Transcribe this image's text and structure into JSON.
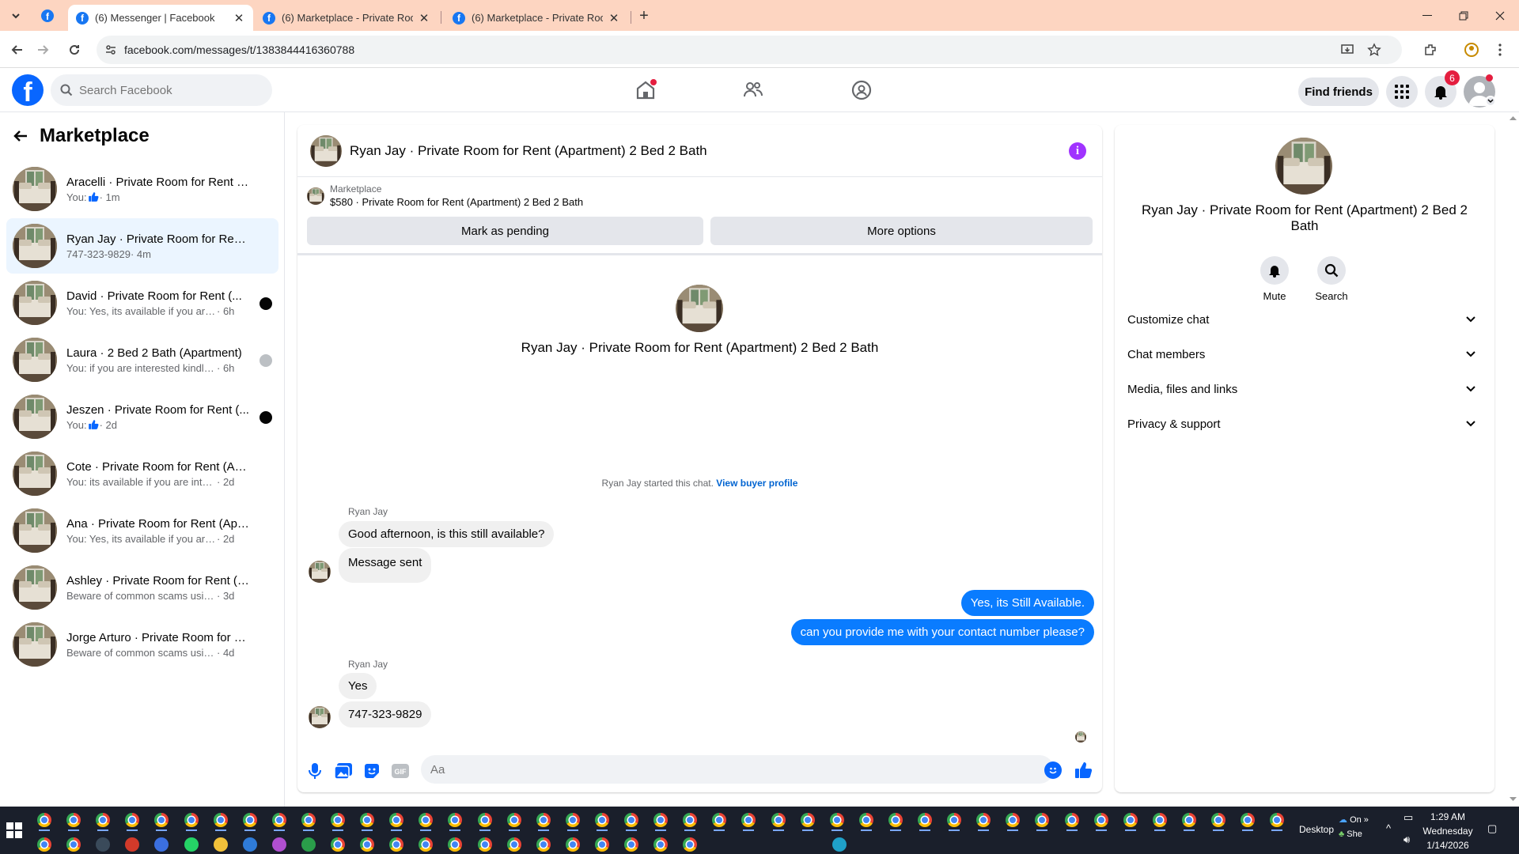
{
  "browser": {
    "tabs": [
      {
        "title": "(6) Messenger | Facebook",
        "active": true
      },
      {
        "title": "(6) Marketplace - Private Room",
        "active": false
      },
      {
        "title": "(6) Marketplace - Private Room",
        "active": false
      }
    ],
    "url": "facebook.com/messages/t/1383844416360788"
  },
  "fb": {
    "search_placeholder": "Search Facebook",
    "find_friends": "Find friends",
    "notification_count": "6",
    "brand_color": "#0866ff"
  },
  "sidebar": {
    "title": "Marketplace",
    "conversations": [
      {
        "name": "Aracelli · Private Room for Rent (A...",
        "preview": "You: ",
        "like": true,
        "time": " · 1m",
        "selected": false,
        "indicator": ""
      },
      {
        "name": "Ryan Jay · Private Room for Rent (...",
        "preview": "747-323-9829",
        "like": false,
        "time": " · 4m",
        "selected": true,
        "indicator": ""
      },
      {
        "name": "David · Private Room for Rent (...",
        "preview": "You: Yes, its available if you are inte...",
        "like": false,
        "time": " · 6h",
        "selected": false,
        "indicator": "avatar-dark"
      },
      {
        "name": "Laura · 2 Bed 2 Bath (Apartment)",
        "preview": "You: if you are interested kindly sha...",
        "like": false,
        "time": " · 6h",
        "selected": false,
        "indicator": "avatar-gray"
      },
      {
        "name": "Jeszen · Private Room for Rent (...",
        "preview": "You: ",
        "like": true,
        "time": " · 2d",
        "selected": false,
        "indicator": "avatar-dark"
      },
      {
        "name": "Cote · Private Room for Rent (Apar...",
        "preview": "You: its available if you are interested ...",
        "like": false,
        "time": " · 2d",
        "selected": false,
        "indicator": ""
      },
      {
        "name": "Ana · Private Room for Rent (Apart...",
        "preview": "You: Yes, its available if you are interes...",
        "like": false,
        "time": " · 2d",
        "selected": false,
        "indicator": ""
      },
      {
        "name": "Ashley · Private Room for Rent (Ap...",
        "preview": "Beware of common scams using pay...",
        "like": false,
        "time": " · 3d",
        "selected": false,
        "indicator": ""
      },
      {
        "name": "Jorge Arturo · Private Room for Re...",
        "preview": "Beware of common scams using pay...",
        "like": false,
        "time": " · 4d",
        "selected": false,
        "indicator": ""
      }
    ]
  },
  "chat": {
    "title": "Ryan Jay · Private Room for Rent (Apartment) 2 Bed 2 Bath",
    "listing_source": "Marketplace",
    "listing_desc": "$580 · Private Room for Rent (Apartment) 2 Bed 2 Bath",
    "mark_pending": "Mark as pending",
    "more_options": "More options",
    "started_text": "Ryan Jay started this chat. ",
    "view_profile": "View buyer profile",
    "messages": [
      {
        "sender": "Ryan Jay",
        "text": "Good afternoon, is this still available?",
        "dir": "in"
      },
      {
        "sender": "",
        "text": "Message sent",
        "dir": "in"
      },
      {
        "sender": "",
        "text": "Yes, its Still Available.",
        "dir": "out"
      },
      {
        "sender": "",
        "text": "can you provide me with your contact number please?",
        "dir": "out"
      },
      {
        "sender": "Ryan Jay",
        "text": "Yes",
        "dir": "in"
      },
      {
        "sender": "",
        "text": "747-323-9829",
        "dir": "in"
      }
    ],
    "composer_placeholder": "Aa",
    "outgoing_color": "#0a7cff"
  },
  "details": {
    "title": "Ryan Jay · Private Room for Rent (Apartment) 2 Bed 2 Bath",
    "actions": [
      "Mute",
      "Search"
    ],
    "sections": [
      "Customize chat",
      "Chat members",
      "Media, files and links",
      "Privacy & support"
    ]
  },
  "taskbar": {
    "desktop_label": "Desktop",
    "weather_top": "On",
    "weather_bottom": "She",
    "time": "1:29 AM",
    "day": "Wednesday",
    "date": "1/14/2026"
  }
}
